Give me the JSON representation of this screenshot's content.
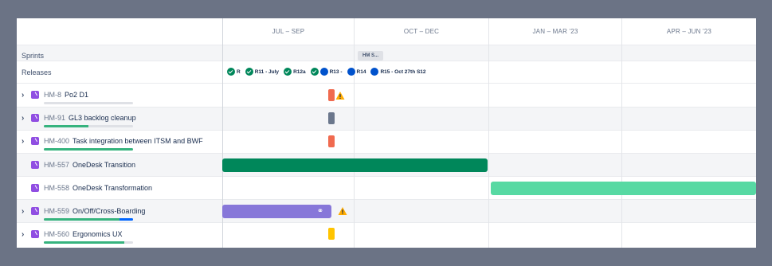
{
  "timeline": {
    "quarters": [
      "JUL – SEP",
      "OCT – DEC",
      "JAN – MAR '23",
      "APR – JUN '23"
    ]
  },
  "rows": {
    "sprints_label": "Sprints",
    "releases_label": "Releases"
  },
  "sprints": [
    {
      "label": "HM S..."
    }
  ],
  "releases": [
    {
      "label": "R",
      "status": "released"
    },
    {
      "label": "R11 - July",
      "status": "released"
    },
    {
      "label": "R12a",
      "status": "released"
    },
    {
      "label": "R13 -",
      "status": "released+unreleased"
    },
    {
      "label": "R14",
      "status": "unreleased"
    },
    {
      "label": "R15 - Oct 27th S12",
      "status": "unreleased"
    }
  ],
  "issues": [
    {
      "key": "HM-8",
      "summary": "Po2 D1",
      "expandable": true,
      "progress_done": 0,
      "progress_inprogress": 0,
      "bar_color": "#f06a4f",
      "warning": true
    },
    {
      "key": "HM-91",
      "summary": "GL3 backlog cleanup",
      "expandable": true,
      "progress_done": 0.5,
      "progress_inprogress": 0,
      "bar_color": "#6b778c",
      "warning": false
    },
    {
      "key": "HM-400",
      "summary": "Task integration between ITSM and BWF",
      "expandable": true,
      "progress_done": 1.0,
      "progress_inprogress": 0,
      "bar_color": "#f06a4f",
      "warning": false
    },
    {
      "key": "HM-557",
      "summary": "OneDesk Transition",
      "expandable": false,
      "bar_color": "#00875a",
      "warning": false
    },
    {
      "key": "HM-558",
      "summary": "OneDesk Transformation",
      "expandable": false,
      "bar_color": "#57d9a3",
      "warning": false
    },
    {
      "key": "HM-559",
      "summary": "On/Off/Cross-Boarding",
      "expandable": true,
      "progress_done": 0.85,
      "progress_inprogress": 0.15,
      "bar_color": "#8777d9",
      "warning": true,
      "linked": true
    },
    {
      "key": "HM-560",
      "summary": "Ergonomics UX",
      "expandable": true,
      "progress_done": 0.9,
      "progress_inprogress": 0,
      "bar_color": "#ffc400",
      "warning": false
    }
  ],
  "colors": {
    "epic_purple": "#904ee2",
    "warning_yellow": "#ffab00",
    "background": "#6b7385"
  }
}
